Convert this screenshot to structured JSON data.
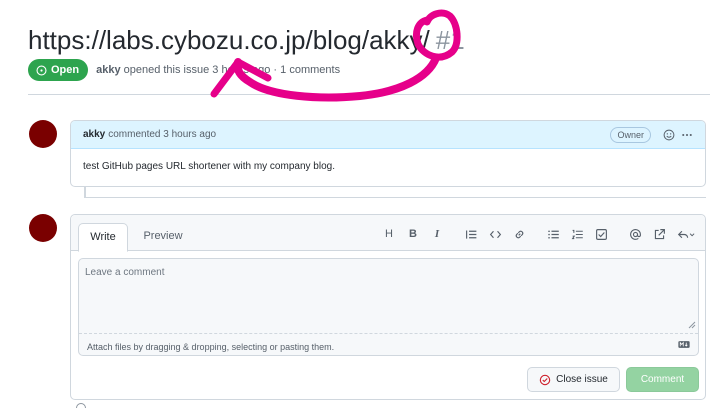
{
  "issue": {
    "title": "https://labs.cybozu.co.jp/blog/akky/",
    "number": "#1",
    "state": "Open",
    "author": "akky",
    "meta_text": "opened this issue 3 hours ago · 1 comments"
  },
  "comment": {
    "author": "akky",
    "action": "commented 3 hours ago",
    "role_badge": "Owner",
    "body": "test GitHub pages URL shortener with my company blog."
  },
  "editor": {
    "tabs": [
      "Write",
      "Preview"
    ],
    "toolbar_icons": [
      "heading-icon",
      "bold-icon",
      "italic-icon",
      "quote-icon",
      "code-icon",
      "link-icon",
      "bulleted-list-icon",
      "numbered-list-icon",
      "task-list-icon",
      "mention-icon",
      "cross-reference-icon",
      "reply-icon"
    ],
    "toolbar_heading": "H",
    "toolbar_bold": "B",
    "toolbar_italic": "I",
    "placeholder": "Leave a comment",
    "attach_hint": "Attach files by dragging & dropping, selecting or pasting them.",
    "close_button": "Close issue",
    "comment_button": "Comment"
  },
  "colors": {
    "open_green": "#2da44e",
    "comment_disabled": "#94d3a2",
    "header_blue": "#ddf4ff",
    "avatar": "#7a0000",
    "annotation_magenta": "#e6008a"
  }
}
